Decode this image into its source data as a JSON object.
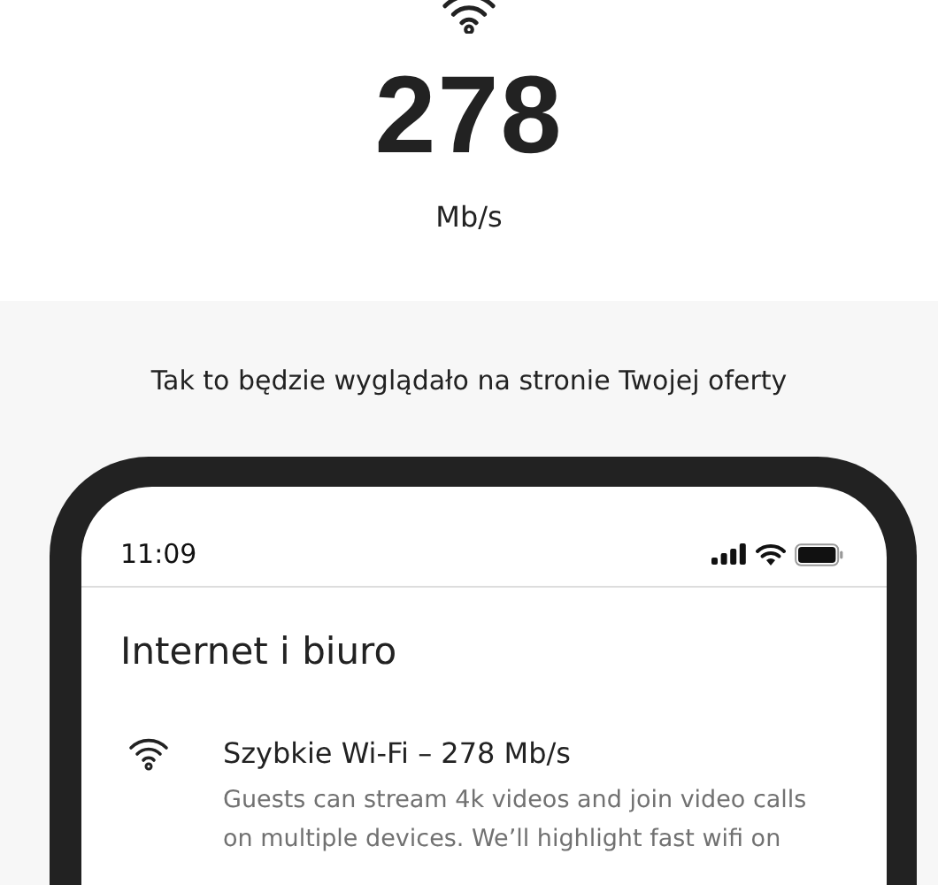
{
  "speed": {
    "value": "278",
    "unit": "Mb/s"
  },
  "caption": "Tak to będzie wyglądało na stronie Twojej oferty",
  "phone": {
    "status_bar": {
      "time": "11:09"
    },
    "section_title": "Internet i biuro",
    "amenities": [
      {
        "kind": "wifi",
        "title": "Szybkie Wi-Fi – 278 Mb/s",
        "description_lines": [
          "Guests can stream 4k videos and join video calls",
          "on multiple devices. We’ll highlight fast wifi on"
        ]
      }
    ]
  }
}
